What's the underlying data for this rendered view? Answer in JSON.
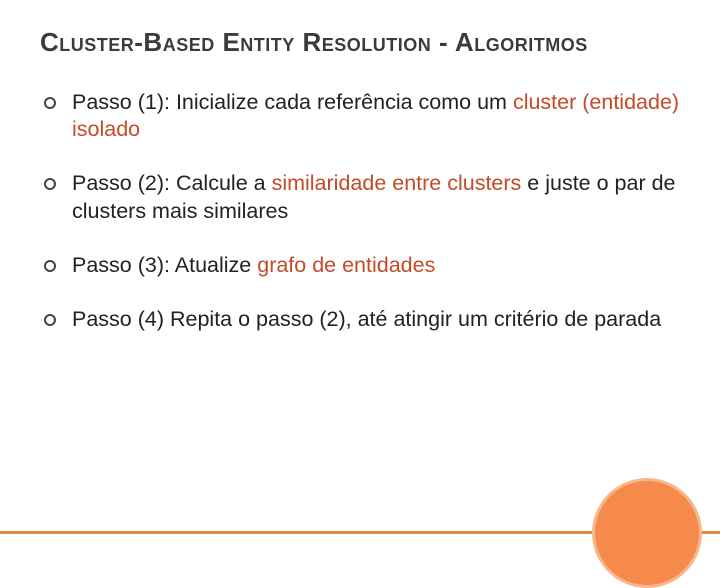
{
  "title": "Cluster-Based Entity Resolution - Algoritmos",
  "bullets": {
    "b0": {
      "p1": "Passo (1): Inicialize cada referência como um ",
      "hl": "cluster (entidade) isolado",
      "p2": ""
    },
    "b1": {
      "p1": "Passo (2): Calcule a ",
      "hl": "similaridade entre clusters",
      "p2": " e juste o par de clusters mais similares"
    },
    "b2": {
      "p1": "Passo (3): Atualize ",
      "hl": "grafo de entidades",
      "p2": ""
    },
    "b3": {
      "p1": "Passo (4) Repita o passo (2), até atingir um critério de parada",
      "hl": "",
      "p2": ""
    }
  }
}
